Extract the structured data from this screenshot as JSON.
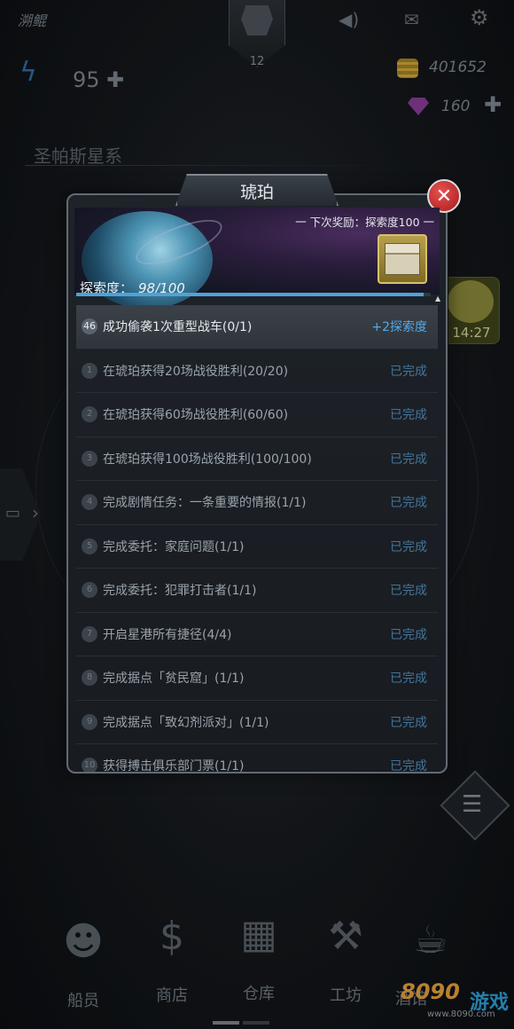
{
  "header": {
    "player_name": "溯鲲",
    "level": "12",
    "energy": "95",
    "coins": "401652",
    "gems": "160",
    "system_name": "圣帕斯星系",
    "plus_glyph": "✚"
  },
  "event_timer": "14:27",
  "modal": {
    "title": "琥珀",
    "close_glyph": "✕",
    "next_reward_label": "一 下次奖励：探索度100 一",
    "progress_label": "探索度：",
    "progress_value": "98/100",
    "progress_fraction": 0.98,
    "tasks": [
      {
        "num": "46",
        "text": "成功偷袭1次重型战车(0/1)",
        "status": "+2探索度",
        "active": true
      },
      {
        "num": "1",
        "text": "在琥珀获得20场战役胜利(20/20)",
        "status": "已完成"
      },
      {
        "num": "2",
        "text": "在琥珀获得60场战役胜利(60/60)",
        "status": "已完成"
      },
      {
        "num": "3",
        "text": "在琥珀获得100场战役胜利(100/100)",
        "status": "已完成"
      },
      {
        "num": "4",
        "text": "完成剧情任务：一条重要的情报(1/1)",
        "status": "已完成"
      },
      {
        "num": "5",
        "text": "完成委托：家庭问题(1/1)",
        "status": "已完成"
      },
      {
        "num": "6",
        "text": "完成委托：犯罪打击者(1/1)",
        "status": "已完成"
      },
      {
        "num": "7",
        "text": "开启星港所有捷径(4/4)",
        "status": "已完成"
      },
      {
        "num": "8",
        "text": "完成据点「贫民窟」(1/1)",
        "status": "已完成"
      },
      {
        "num": "9",
        "text": "完成据点「致幻剂派对」(1/1)",
        "status": "已完成"
      },
      {
        "num": "10",
        "text": "获得搏击俱乐部门票(1/1)",
        "status": "已完成"
      }
    ]
  },
  "nav": [
    {
      "label": "船员",
      "icon": "crew-icon",
      "glyph": "☻"
    },
    {
      "label": "商店",
      "icon": "shop-icon",
      "glyph": "$"
    },
    {
      "label": "仓库",
      "icon": "warehouse-icon",
      "glyph": "▦"
    },
    {
      "label": "工坊",
      "icon": "workshop-icon",
      "glyph": "⚒"
    },
    {
      "label": "酒馆",
      "icon": "tavern-icon",
      "glyph": "☕"
    }
  ],
  "watermark": {
    "brand": "8090",
    "tail": "游戏",
    "url": "www.8090.com"
  }
}
